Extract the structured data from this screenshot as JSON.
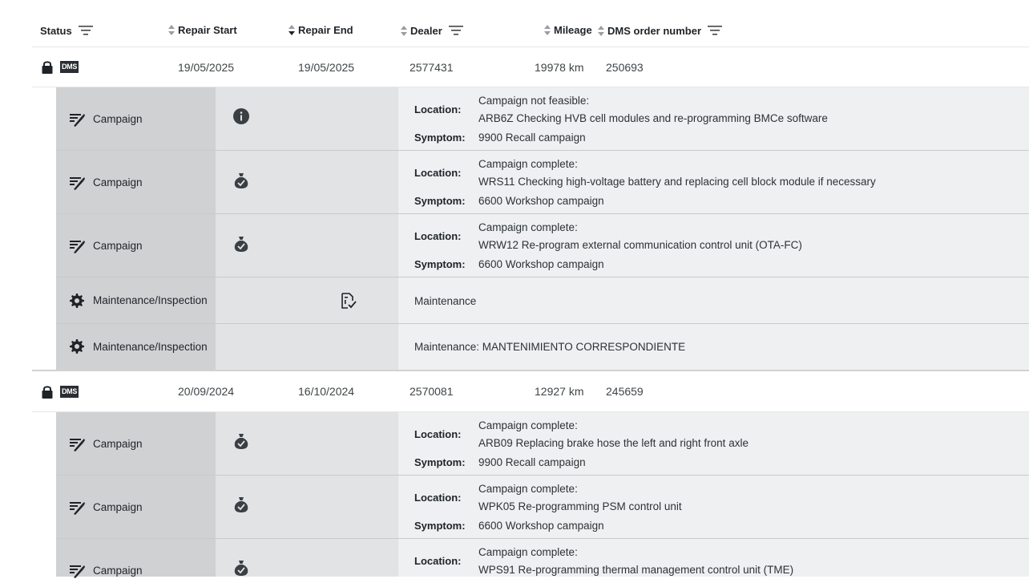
{
  "header": {
    "status": "Status",
    "repair_start": "Repair Start",
    "repair_end": "Repair End",
    "dealer": "Dealer",
    "mileage": "Mileage",
    "dms_order": "DMS order number"
  },
  "dms_badge": "DMS",
  "labels": {
    "location": "Location:",
    "symptom": "Symptom:"
  },
  "groups": [
    {
      "repair_start": "19/05/2025",
      "repair_end": "19/05/2025",
      "dealer": "2577431",
      "mileage": "19978 km",
      "dms_order": "250693",
      "items": [
        {
          "type": "Campaign",
          "status_icon": "info-icon",
          "location_status": "Campaign not feasible:",
          "location_detail": "ARB6Z Checking HVB cell modules and re-programming BMCe software",
          "symptom": "9900 Recall campaign"
        },
        {
          "type": "Campaign",
          "status_icon": "money-bag-icon",
          "location_status": "Campaign complete:",
          "location_detail": "WRS11 Checking high-voltage battery and replacing cell block module if necessary",
          "symptom": "6600 Workshop campaign"
        },
        {
          "type": "Campaign",
          "status_icon": "money-bag-icon",
          "location_status": "Campaign complete:",
          "location_detail": "WRW12 Re-program external communication control unit (OTA-FC)",
          "symptom": "6600 Workshop campaign"
        },
        {
          "type": "Maintenance/Inspection",
          "status_icon": "document-check-icon",
          "text": "Maintenance"
        },
        {
          "type": "Maintenance/Inspection",
          "text": "Maintenance: MANTENIMIENTO CORRESPONDIENTE"
        }
      ]
    },
    {
      "repair_start": "20/09/2024",
      "repair_end": "16/10/2024",
      "dealer": "2570081",
      "mileage": "12927 km",
      "dms_order": "245659",
      "items": [
        {
          "type": "Campaign",
          "status_icon": "money-bag-icon",
          "location_status": "Campaign complete:",
          "location_detail": "ARB09 Replacing brake hose the left and right front axle",
          "symptom": "9900 Recall campaign"
        },
        {
          "type": "Campaign",
          "status_icon": "money-bag-icon",
          "location_status": "Campaign complete:",
          "location_detail": "WPK05 Re-programming PSM control unit",
          "symptom": "6600 Workshop campaign"
        },
        {
          "type": "Campaign",
          "status_icon": "money-bag-icon",
          "location_status": "Campaign complete:",
          "location_detail": "WPS91 Re-programming thermal management control unit (TME)"
        }
      ]
    }
  ]
}
